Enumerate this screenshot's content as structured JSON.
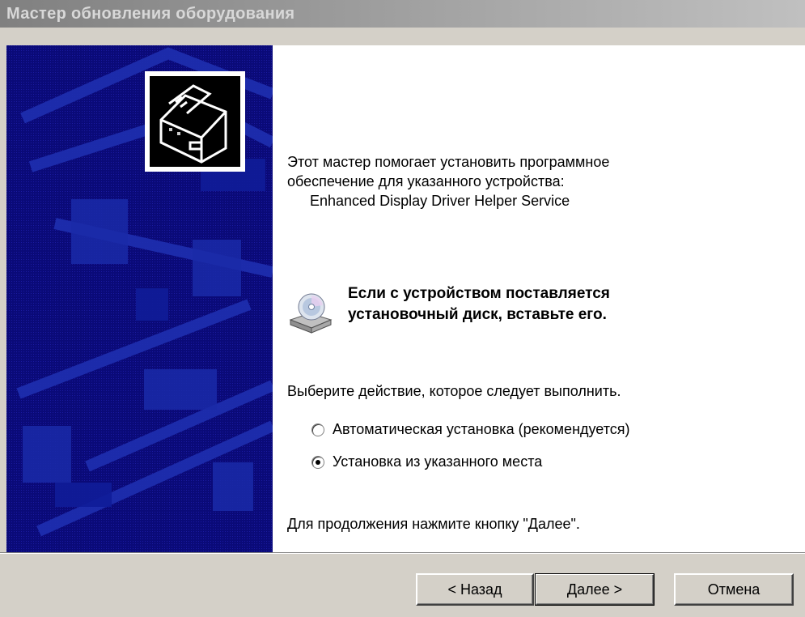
{
  "window": {
    "title": "Мастер обновления оборудования"
  },
  "intro": {
    "line1": "Этот мастер помогает установить программное",
    "line2": "обеспечение для указанного устройства:",
    "device": "Enhanced Display Driver Helper Service"
  },
  "disk_prompt": {
    "line1": "Если с устройством поставляется",
    "line2": "установочный диск, вставьте его."
  },
  "choose_action": "Выберите действие, которое следует выполнить.",
  "options": [
    {
      "label": "Автоматическая установка (рекомендуется)",
      "selected": false
    },
    {
      "label": "Установка из указанного места",
      "selected": true
    }
  ],
  "continue_hint": "Для продолжения нажмите кнопку \"Далее\".",
  "buttons": {
    "back": "< Назад",
    "next": "Далее >",
    "cancel": "Отмена"
  },
  "colors": {
    "side_panel": "#0a0a7a",
    "dialog_face": "#d4d0c8"
  },
  "icons": {
    "wizard": "hardware-wizard-icon",
    "disk": "cd-drive-icon"
  }
}
